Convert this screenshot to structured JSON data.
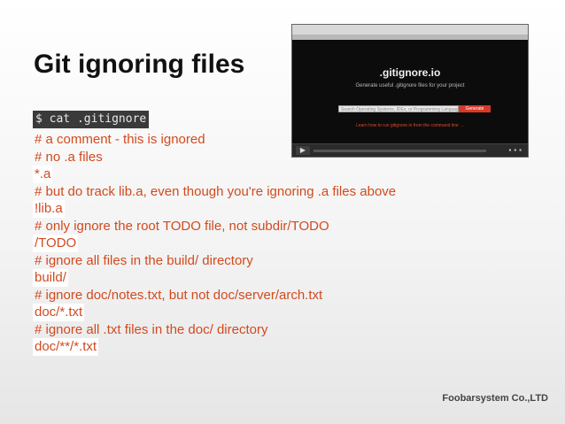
{
  "slide": {
    "title": "Git ignoring files",
    "command": "$ cat .gitignore",
    "lines": [
      "# a comment - this is ignored",
      "# no .a files",
      "*.a",
      "# but do track lib.a, even though you're ignoring .a files above",
      "!lib.a",
      "# only ignore the root TODO file, not subdir/TODO",
      "/TODO",
      "# ignore all files in the build/ directory",
      "build/",
      "# ignore doc/notes.txt, but not doc/server/arch.txt",
      "doc/*.txt",
      "# ignore all .txt files in the doc/ directory",
      "doc/**/*.txt"
    ],
    "footer": "Foobarsystem Co.,LTD"
  },
  "video": {
    "brand": ".gitignore.io",
    "tagline": "Generate useful .gitignore files for your project",
    "search_placeholder": "Search Operating Systems, IDEs, or Programming Languages",
    "button_label": "Generate",
    "link_text": "Learn how to run gitignore.io from the command line →",
    "play_icon": "play-icon"
  },
  "colors": {
    "code_text": "#d24a1e",
    "command_bg": "#3a3a3a",
    "video_bg": "#0c0c0c",
    "video_button": "#d83a2a"
  }
}
